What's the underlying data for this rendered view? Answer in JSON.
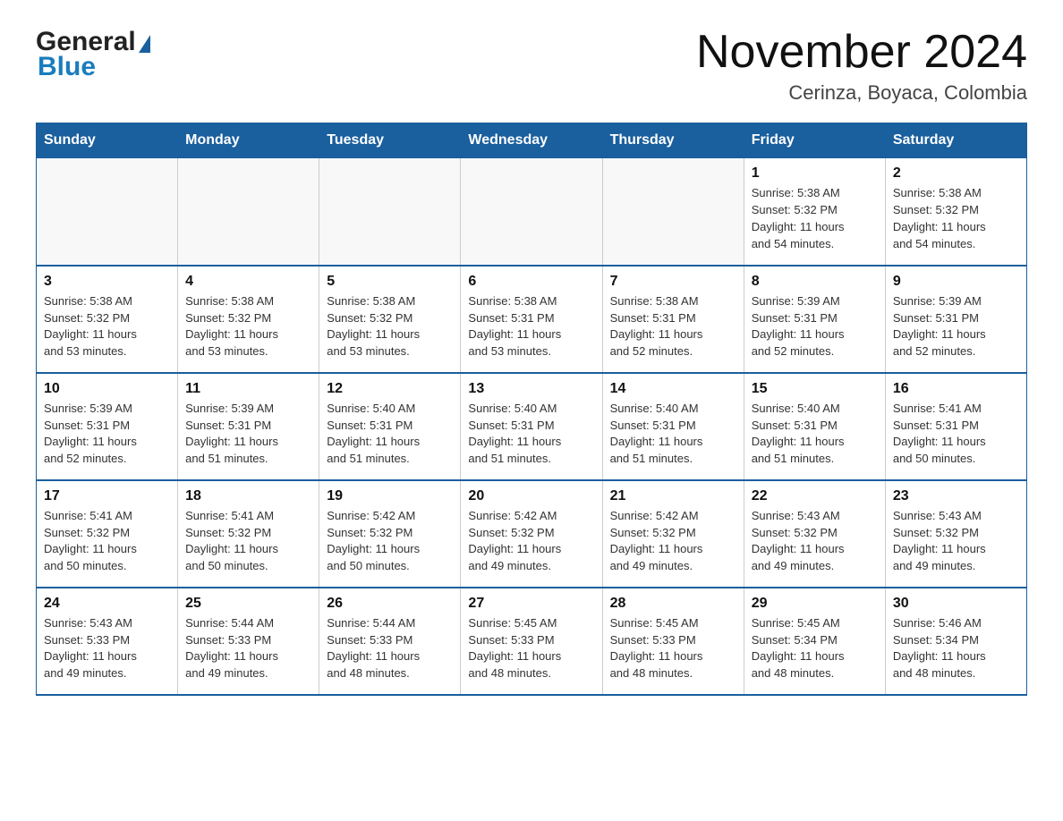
{
  "logo": {
    "general_text": "General",
    "blue_text": "Blue"
  },
  "title": {
    "month_year": "November 2024",
    "location": "Cerinza, Boyaca, Colombia"
  },
  "weekdays": [
    "Sunday",
    "Monday",
    "Tuesday",
    "Wednesday",
    "Thursday",
    "Friday",
    "Saturday"
  ],
  "weeks": [
    [
      {
        "day": "",
        "info": ""
      },
      {
        "day": "",
        "info": ""
      },
      {
        "day": "",
        "info": ""
      },
      {
        "day": "",
        "info": ""
      },
      {
        "day": "",
        "info": ""
      },
      {
        "day": "1",
        "info": "Sunrise: 5:38 AM\nSunset: 5:32 PM\nDaylight: 11 hours\nand 54 minutes."
      },
      {
        "day": "2",
        "info": "Sunrise: 5:38 AM\nSunset: 5:32 PM\nDaylight: 11 hours\nand 54 minutes."
      }
    ],
    [
      {
        "day": "3",
        "info": "Sunrise: 5:38 AM\nSunset: 5:32 PM\nDaylight: 11 hours\nand 53 minutes."
      },
      {
        "day": "4",
        "info": "Sunrise: 5:38 AM\nSunset: 5:32 PM\nDaylight: 11 hours\nand 53 minutes."
      },
      {
        "day": "5",
        "info": "Sunrise: 5:38 AM\nSunset: 5:32 PM\nDaylight: 11 hours\nand 53 minutes."
      },
      {
        "day": "6",
        "info": "Sunrise: 5:38 AM\nSunset: 5:31 PM\nDaylight: 11 hours\nand 53 minutes."
      },
      {
        "day": "7",
        "info": "Sunrise: 5:38 AM\nSunset: 5:31 PM\nDaylight: 11 hours\nand 52 minutes."
      },
      {
        "day": "8",
        "info": "Sunrise: 5:39 AM\nSunset: 5:31 PM\nDaylight: 11 hours\nand 52 minutes."
      },
      {
        "day": "9",
        "info": "Sunrise: 5:39 AM\nSunset: 5:31 PM\nDaylight: 11 hours\nand 52 minutes."
      }
    ],
    [
      {
        "day": "10",
        "info": "Sunrise: 5:39 AM\nSunset: 5:31 PM\nDaylight: 11 hours\nand 52 minutes."
      },
      {
        "day": "11",
        "info": "Sunrise: 5:39 AM\nSunset: 5:31 PM\nDaylight: 11 hours\nand 51 minutes."
      },
      {
        "day": "12",
        "info": "Sunrise: 5:40 AM\nSunset: 5:31 PM\nDaylight: 11 hours\nand 51 minutes."
      },
      {
        "day": "13",
        "info": "Sunrise: 5:40 AM\nSunset: 5:31 PM\nDaylight: 11 hours\nand 51 minutes."
      },
      {
        "day": "14",
        "info": "Sunrise: 5:40 AM\nSunset: 5:31 PM\nDaylight: 11 hours\nand 51 minutes."
      },
      {
        "day": "15",
        "info": "Sunrise: 5:40 AM\nSunset: 5:31 PM\nDaylight: 11 hours\nand 51 minutes."
      },
      {
        "day": "16",
        "info": "Sunrise: 5:41 AM\nSunset: 5:31 PM\nDaylight: 11 hours\nand 50 minutes."
      }
    ],
    [
      {
        "day": "17",
        "info": "Sunrise: 5:41 AM\nSunset: 5:32 PM\nDaylight: 11 hours\nand 50 minutes."
      },
      {
        "day": "18",
        "info": "Sunrise: 5:41 AM\nSunset: 5:32 PM\nDaylight: 11 hours\nand 50 minutes."
      },
      {
        "day": "19",
        "info": "Sunrise: 5:42 AM\nSunset: 5:32 PM\nDaylight: 11 hours\nand 50 minutes."
      },
      {
        "day": "20",
        "info": "Sunrise: 5:42 AM\nSunset: 5:32 PM\nDaylight: 11 hours\nand 49 minutes."
      },
      {
        "day": "21",
        "info": "Sunrise: 5:42 AM\nSunset: 5:32 PM\nDaylight: 11 hours\nand 49 minutes."
      },
      {
        "day": "22",
        "info": "Sunrise: 5:43 AM\nSunset: 5:32 PM\nDaylight: 11 hours\nand 49 minutes."
      },
      {
        "day": "23",
        "info": "Sunrise: 5:43 AM\nSunset: 5:32 PM\nDaylight: 11 hours\nand 49 minutes."
      }
    ],
    [
      {
        "day": "24",
        "info": "Sunrise: 5:43 AM\nSunset: 5:33 PM\nDaylight: 11 hours\nand 49 minutes."
      },
      {
        "day": "25",
        "info": "Sunrise: 5:44 AM\nSunset: 5:33 PM\nDaylight: 11 hours\nand 49 minutes."
      },
      {
        "day": "26",
        "info": "Sunrise: 5:44 AM\nSunset: 5:33 PM\nDaylight: 11 hours\nand 48 minutes."
      },
      {
        "day": "27",
        "info": "Sunrise: 5:45 AM\nSunset: 5:33 PM\nDaylight: 11 hours\nand 48 minutes."
      },
      {
        "day": "28",
        "info": "Sunrise: 5:45 AM\nSunset: 5:33 PM\nDaylight: 11 hours\nand 48 minutes."
      },
      {
        "day": "29",
        "info": "Sunrise: 5:45 AM\nSunset: 5:34 PM\nDaylight: 11 hours\nand 48 minutes."
      },
      {
        "day": "30",
        "info": "Sunrise: 5:46 AM\nSunset: 5:34 PM\nDaylight: 11 hours\nand 48 minutes."
      }
    ]
  ]
}
